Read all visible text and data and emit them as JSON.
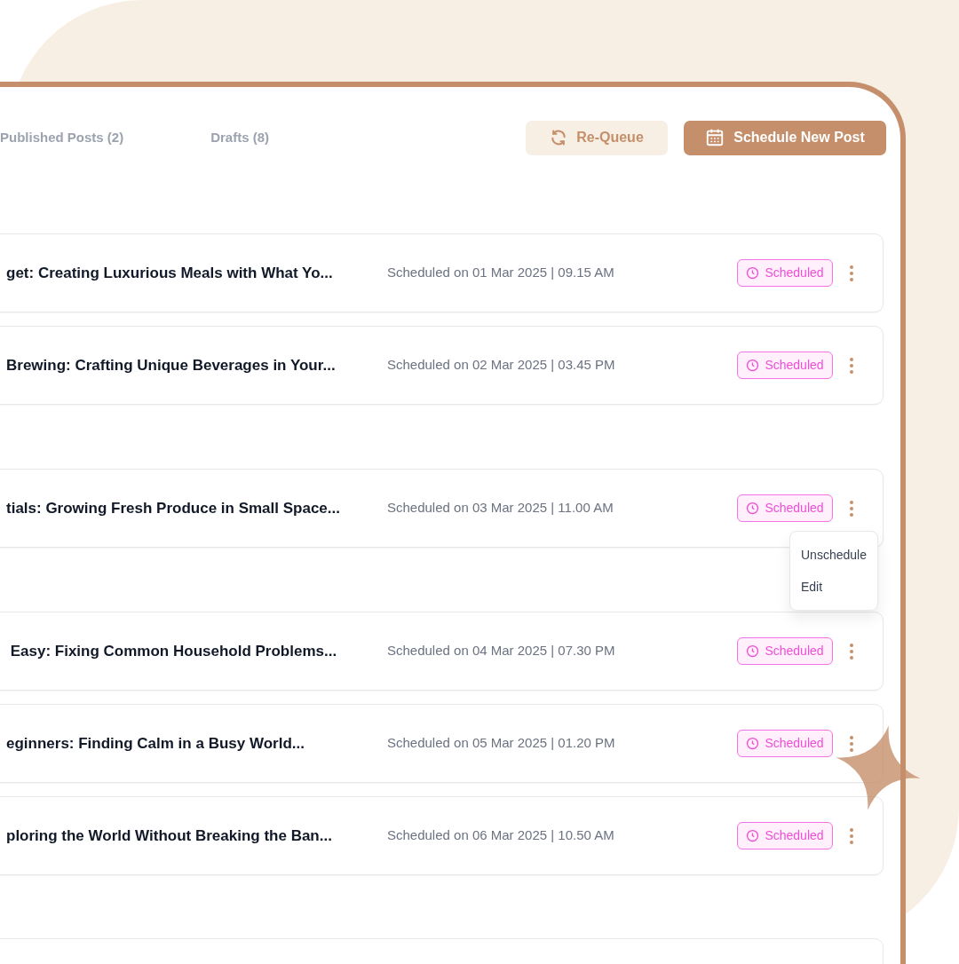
{
  "tabs": [
    {
      "label": "Published Posts (2)",
      "selected": false
    },
    {
      "label": "Drafts (8)",
      "selected": false
    }
  ],
  "actions": [
    {
      "kind": "secondary",
      "label": "Re-Queue"
    },
    {
      "kind": "primary",
      "label": "Schedule New Post"
    }
  ],
  "post_groups": [
    {
      "posts": [
        {
          "title": "get: Creating Luxurious Meals with What Yo...",
          "schedule": "Scheduled on 01 Mar 2025 | 09.15 AM",
          "status": "Scheduled"
        },
        {
          "title": "Brewing: Crafting Unique Beverages in Your...",
          "schedule": "Scheduled on 02 Mar 2025 | 03.45 PM",
          "status": "Scheduled"
        }
      ]
    },
    {
      "posts": [
        {
          "title": "tials: Growing Fresh Produce in Small Space...",
          "schedule": "Scheduled on 03 Mar 2025 | 11.00 AM",
          "status": "Scheduled",
          "menu": [
            "Unschedule",
            "Edit"
          ]
        }
      ]
    },
    {
      "posts": [
        {
          "title": " Easy: Fixing Common Household Problems...",
          "schedule": "Scheduled on 04 Mar 2025 | 07.30 PM",
          "status": "Scheduled"
        },
        {
          "title": "eginners: Finding Calm in a Busy World...",
          "schedule": "Scheduled on 05 Mar 2025 | 01.20 PM",
          "status": "Scheduled"
        },
        {
          "title": "ploring the World Without Breaking the Ban...",
          "schedule": "Scheduled on 06 Mar 2025 | 10.50 AM",
          "status": "Scheduled"
        }
      ]
    }
  ]
}
